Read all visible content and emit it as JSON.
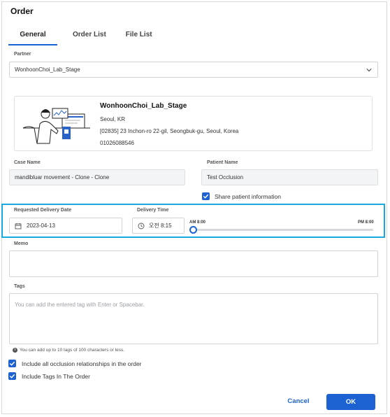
{
  "dialog": {
    "title": "Order"
  },
  "tabs": [
    {
      "label": "General"
    },
    {
      "label": "Order List"
    },
    {
      "label": "File List"
    }
  ],
  "partner": {
    "label": "Partner",
    "value": "WonhoonChoi_Lab_Stage"
  },
  "partner_card": {
    "name": "WonhoonChoi_Lab_Stage",
    "city": "Seoul, KR",
    "address": "[02835] 23 Inchon-ro 22-gil, Seongbuk-gu, Seoul, Korea",
    "phone": "01026088546"
  },
  "case": {
    "label": "Case Name",
    "value": "mandibluar movement - Clone - Clone"
  },
  "patient": {
    "label": "Patient Name",
    "value": "Test Occlusion",
    "share_label": "Share patient information",
    "share_checked": true
  },
  "delivery": {
    "date_label": "Requested Delivery Date",
    "date_value": "2023-04-13",
    "time_label": "Delivery Time",
    "time_value": "오전 8:15",
    "slider_min_label": "AM 8:00",
    "slider_max_label": "PM 8:00",
    "slider_fraction": 0.02
  },
  "memo": {
    "label": "Memo",
    "value": ""
  },
  "tags": {
    "label": "Tags",
    "placeholder": "You can add the entered tag with Enter or Spacebar.",
    "hint": "You can add up to 10 tags of 100 characters or less."
  },
  "options": [
    {
      "label": "Include all occlusion relationships in the order",
      "checked": true
    },
    {
      "label": "Include Tags In The Order",
      "checked": true
    }
  ],
  "actions": {
    "cancel": "Cancel",
    "ok": "OK"
  },
  "colors": {
    "accent": "#1c62d3",
    "highlight": "#1aa8e0"
  }
}
